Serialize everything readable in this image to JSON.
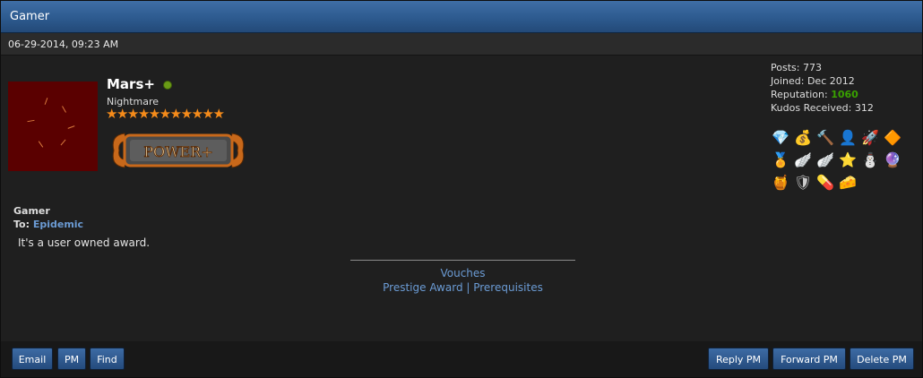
{
  "header": {
    "title": "Gamer"
  },
  "post": {
    "date": "06-29-2014, 09:23 AM"
  },
  "user": {
    "name": "Mars+",
    "title": "Nightmare",
    "stars": "★★★★★★★★★★★",
    "rank_label": "POWER+",
    "stats": {
      "posts": "Posts: 773",
      "joined": "Joined: Dec 2012",
      "reputation_label": "Reputation: ",
      "reputation_value": "1060",
      "kudos": "Kudos Received: 312"
    },
    "awards": [
      "💎",
      "💰",
      "🔨",
      "👤",
      "🚀",
      "🔶",
      "🏅",
      "🪽",
      "🪽",
      "⭐",
      "⛄",
      "🔮",
      "🍯",
      "🛡",
      "💊",
      "🧀"
    ]
  },
  "message": {
    "title": "Gamer",
    "to_label": "To: ",
    "to_name": "Epidemic",
    "body": "It's a user owned award."
  },
  "signature": {
    "line1": "Vouches",
    "line2": "Prestige Award | Prerequisites"
  },
  "buttons": {
    "email": "Email",
    "pm": "PM",
    "find": "Find",
    "reply_pm": "Reply PM",
    "forward_pm": "Forward PM",
    "delete_pm": "Delete PM"
  },
  "colors": {
    "accent": "#2d5a8f",
    "link": "#6b9bd4",
    "reputation": "#39a100",
    "star": "#f58b1a"
  }
}
